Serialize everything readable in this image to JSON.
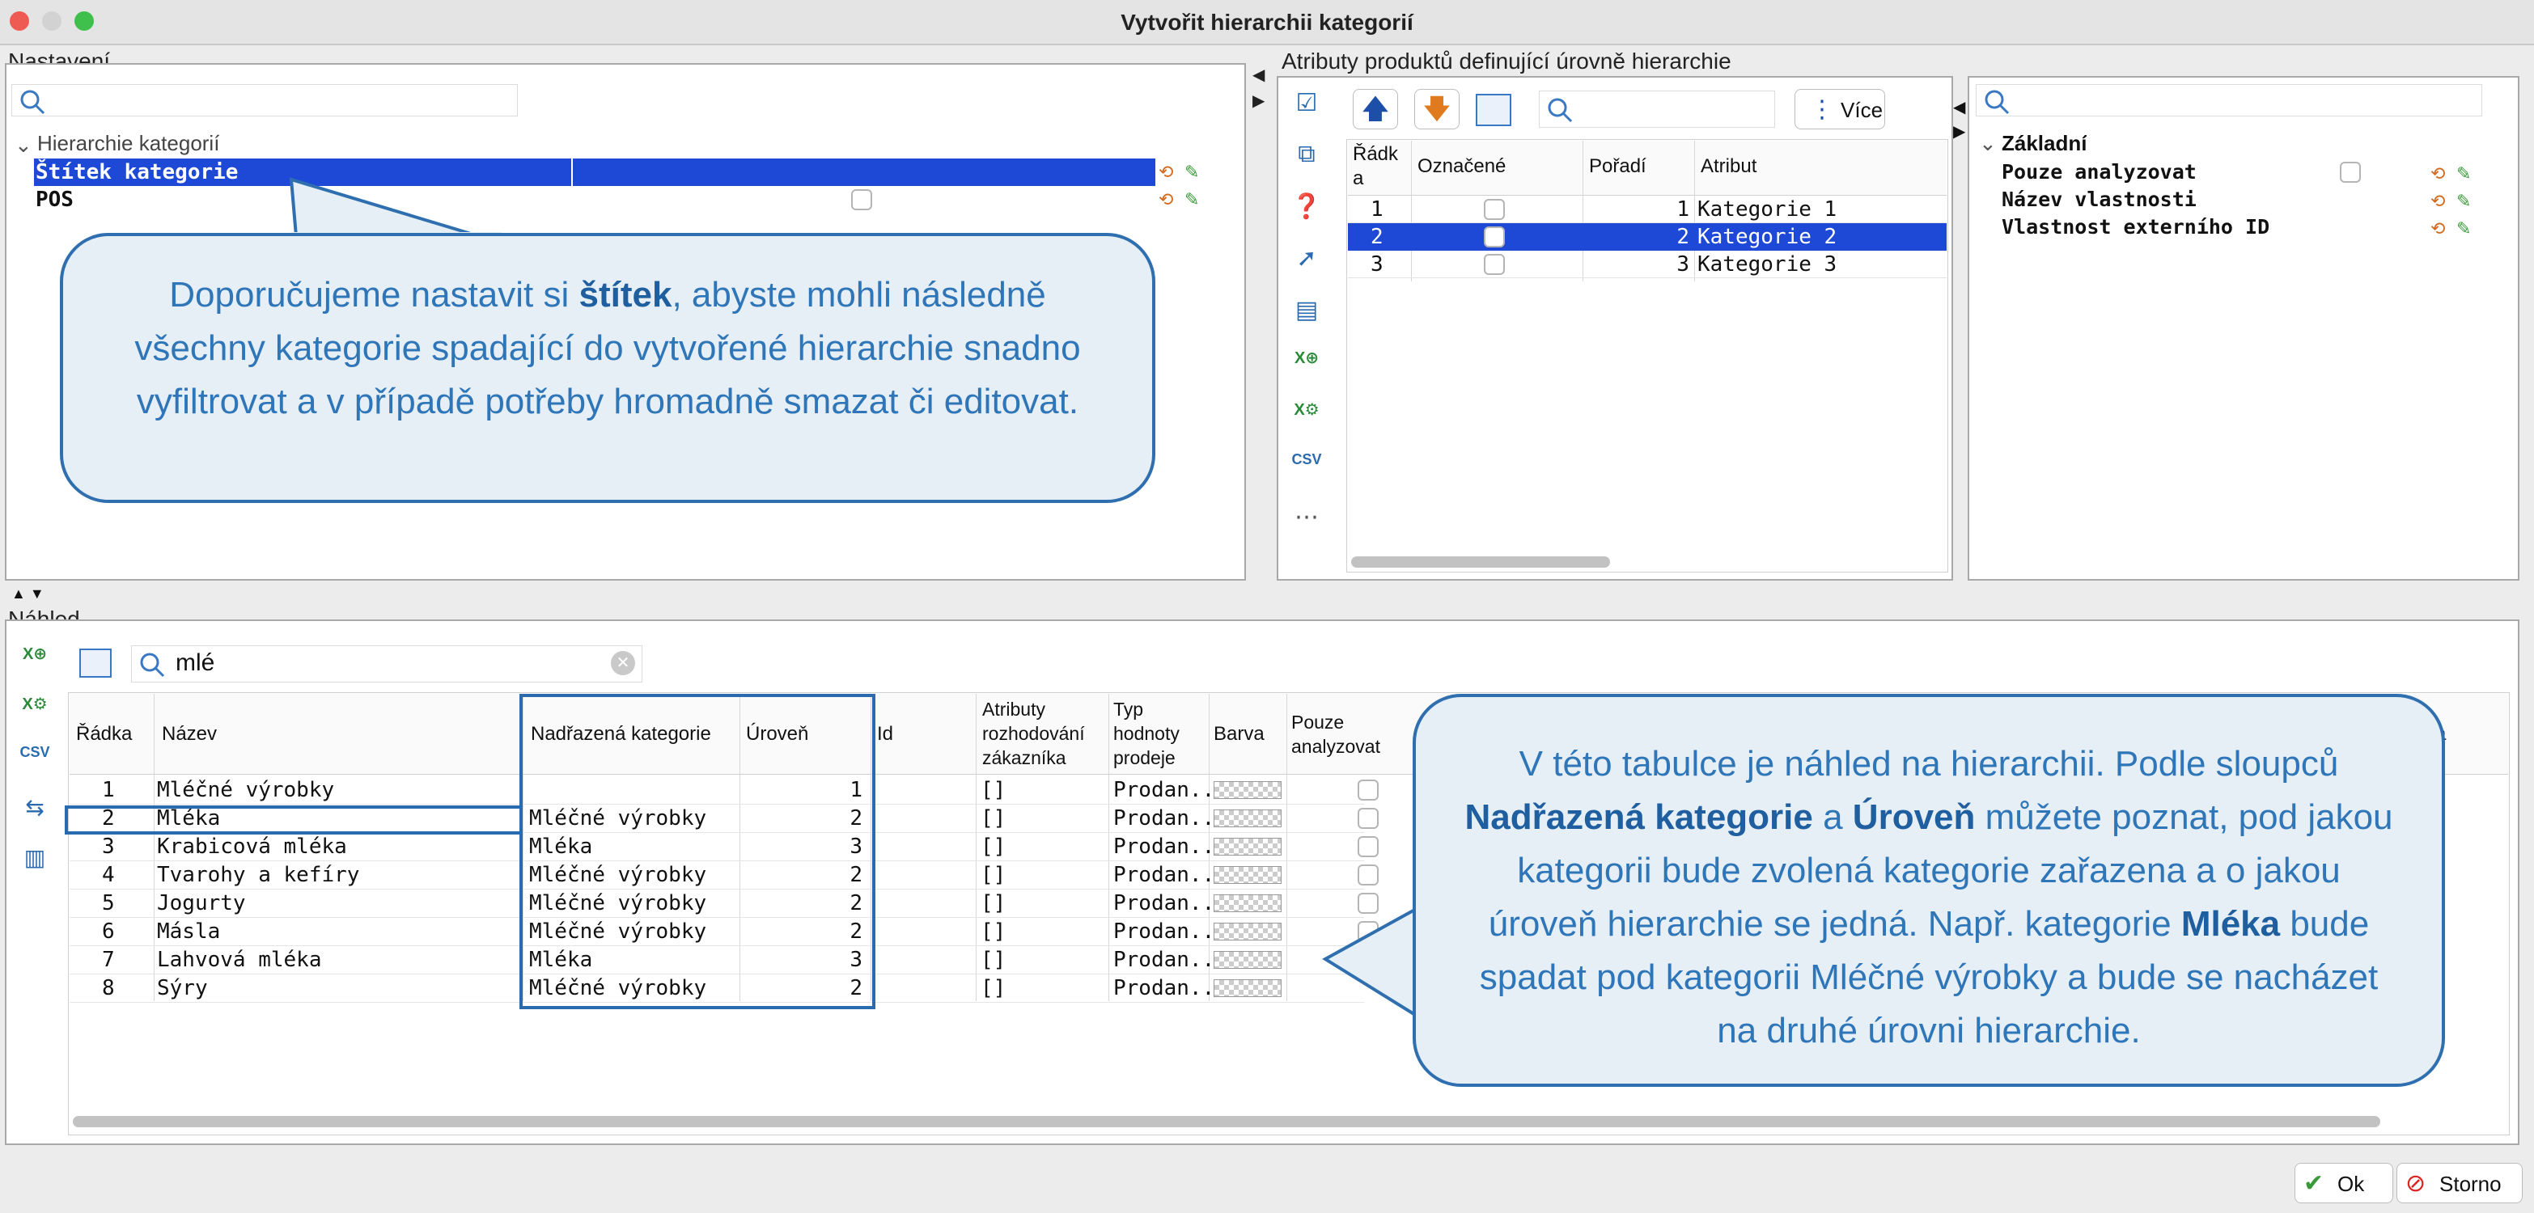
{
  "window": {
    "title": "Vytvořit hierarchii kategorií"
  },
  "nastaveni": {
    "label": "Nastavení",
    "group": "Hierarchie kategorií",
    "rows": [
      {
        "label": "Štítek kategorie",
        "selected": true
      },
      {
        "label": "POS",
        "selected": false
      }
    ]
  },
  "atributy": {
    "label": "Atributy produktů definující úrovně hierarchie",
    "more_button": "Více",
    "headers": {
      "radka": "Řádk a",
      "oznacene": "Označené",
      "poradi": "Pořadí",
      "atribut": "Atribut"
    },
    "rows": [
      {
        "radka": "1",
        "poradi": "1",
        "atribut": "Kategorie 1",
        "selected": false
      },
      {
        "radka": "2",
        "poradi": "2",
        "atribut": "Kategorie 2",
        "selected": true
      },
      {
        "radka": "3",
        "poradi": "3",
        "atribut": "Kategorie 3",
        "selected": false
      }
    ],
    "side_icons": [
      "checklist-icon",
      "copy-icon",
      "help-doc-icon",
      "select-cursor-icon",
      "clipboard-icon",
      "excel-import-icon",
      "excel-settings-icon",
      "csv-import-icon",
      "more-dots-icon"
    ]
  },
  "vlastnosti": {
    "group": "Základní",
    "rows": [
      {
        "label": "Pouze analyzovat"
      },
      {
        "label": "Název vlastnosti"
      },
      {
        "label": "Vlastnost externího ID"
      }
    ]
  },
  "nahled": {
    "label": "Náhled",
    "search_value": "mlé",
    "headers": {
      "radka": "Řádka",
      "nazev": "Název",
      "nadrazena": "Nadřazená kategorie",
      "uroven": "Úroveň",
      "id": "Id",
      "atributy": "Atributy rozhodování zákazníka",
      "typ": "Typ hodnoty prodeje",
      "barva": "Barva",
      "pouze": "Pouze analyzovat",
      "last": "a"
    },
    "rows": [
      {
        "radka": "1",
        "nazev": "Mléčné výrobky",
        "nadrazena": "",
        "uroven": "1",
        "atr": "[]",
        "typ": "Prodan..."
      },
      {
        "radka": "2",
        "nazev": "Mléka",
        "nadrazena": "Mléčné výrobky",
        "uroven": "2",
        "atr": "[]",
        "typ": "Prodan..."
      },
      {
        "radka": "3",
        "nazev": "Krabicová mléka",
        "nadrazena": "Mléka",
        "uroven": "3",
        "atr": "[]",
        "typ": "Prodan..."
      },
      {
        "radka": "4",
        "nazev": "Tvarohy a kefíry",
        "nadrazena": "Mléčné výrobky",
        "uroven": "2",
        "atr": "[]",
        "typ": "Prodan..."
      },
      {
        "radka": "5",
        "nazev": "Jogurty",
        "nadrazena": "Mléčné výrobky",
        "uroven": "2",
        "atr": "[]",
        "typ": "Prodan..."
      },
      {
        "radka": "6",
        "nazev": "Másla",
        "nadrazena": "Mléčné výrobky",
        "uroven": "2",
        "atr": "[]",
        "typ": "Prodan..."
      },
      {
        "radka": "7",
        "nazev": "Lahvová mléka",
        "nadrazena": "Mléka",
        "uroven": "3",
        "atr": "[]",
        "typ": "Prodan..."
      },
      {
        "radka": "8",
        "nazev": "Sýry",
        "nadrazena": "Mléčné výrobky",
        "uroven": "2",
        "atr": "[]",
        "typ": "Prodan..."
      }
    ]
  },
  "callout1": {
    "pre": "Doporučujeme nastavit si ",
    "bold": "štítek",
    "post": ", abyste mohli následně všechny kategorie spadající do vytvořené hierarchie snadno vyfiltrovat a v případě potřeby hromadně smazat či editovat."
  },
  "callout2": {
    "t1": "V této tabulce je náhled na hierarchii. Podle sloupců ",
    "b1": "Nadřazená kategorie",
    "t2": " a ",
    "b2": "Úroveň",
    "t3": " můžete poznat, pod jakou kategorii bude zvolená kategorie zařazena a o jakou úroveň hierarchie se jedná. Např. kategorie ",
    "b3": "Mléka",
    "t4": " bude spadat pod kategorii Mléčné výrobky a bude se nacházet na druhé úrovni hierarchie."
  },
  "footer": {
    "ok": "Ok",
    "storno": "Storno"
  },
  "colors": {
    "selection": "#1d49d6",
    "callout_border": "#2f6fb0",
    "callout_text": "#2f76b8",
    "callout_bg": "#e6eef6"
  }
}
